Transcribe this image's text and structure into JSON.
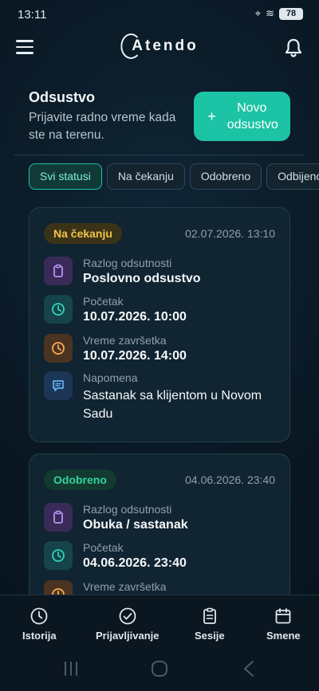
{
  "status_bar": {
    "time": "13:11",
    "battery": "78"
  },
  "header": {
    "logo_text": "Atendo"
  },
  "page": {
    "title": "Odsustvo",
    "subtitle": "Prijavite radno vreme kada ste na terenu.",
    "new_button": {
      "plus": "+",
      "label": "Novo odsustvo"
    }
  },
  "filters": [
    {
      "label": "Svi statusi",
      "active": true
    },
    {
      "label": "Na čekanju",
      "active": false
    },
    {
      "label": "Odobreno",
      "active": false
    },
    {
      "label": "Odbijeno",
      "active": false
    }
  ],
  "cards": [
    {
      "status": "Na čekanju",
      "created": "02.07.2026. 13:10",
      "reason_label": "Razlog odsutnosti",
      "reason": "Poslovno odsustvo",
      "start_label": "Početak",
      "start": "10.07.2026. 10:00",
      "end_label": "Vreme završetka",
      "end": "10.07.2026. 14:00",
      "note_label": "Napomena",
      "note": "Sastanak sa klijentom u Novom Sadu"
    },
    {
      "status": "Odobreno",
      "created": "04.06.2026. 23:40",
      "reason_label": "Razlog odsutnosti",
      "reason": "Obuka / sastanak",
      "start_label": "Početak",
      "start": "04.06.2026. 23:40",
      "end_label": "Vreme završetka"
    }
  ],
  "bottom_nav": [
    {
      "label": "Istorija",
      "icon": "clock-icon"
    },
    {
      "label": "Prijavljivanje",
      "icon": "check-circle-icon"
    },
    {
      "label": "Sesije",
      "icon": "clipboard-icon"
    },
    {
      "label": "Smene",
      "icon": "calendar-icon"
    }
  ],
  "colors": {
    "accent": "#1cc3a5",
    "pending": "#f0c24a",
    "approved": "#34d399",
    "background": "#0a1824"
  }
}
